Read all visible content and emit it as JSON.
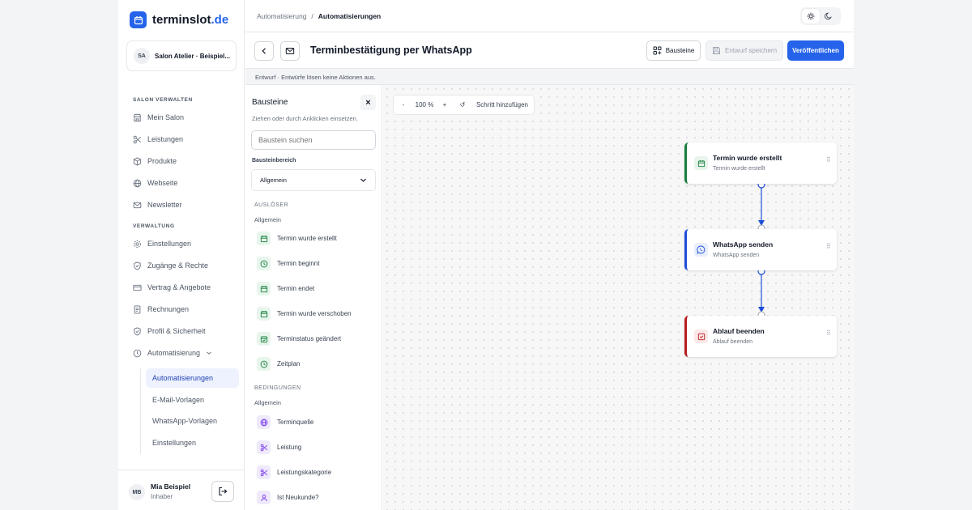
{
  "app": {
    "logo_name": "terminslot",
    "logo_tld": ".de"
  },
  "salon": {
    "initials": "SA",
    "name": "Salon Atelier · Beispiel..."
  },
  "sidebar": {
    "section_salon": "SALON VERWALTEN",
    "section_admin": "VERWALTUNG",
    "items": [
      {
        "label": "Mein Salon",
        "icon": "store-icon"
      },
      {
        "label": "Leistungen",
        "icon": "scissors-icon"
      },
      {
        "label": "Produkte",
        "icon": "box-icon"
      },
      {
        "label": "Webseite",
        "icon": "globe-icon"
      },
      {
        "label": "Newsletter",
        "icon": "mail-icon"
      },
      {
        "label": "Einstellungen",
        "icon": "gear-icon"
      },
      {
        "label": "Zugänge & Rechte",
        "icon": "shield-icon"
      },
      {
        "label": "Vertrag & Angebote",
        "icon": "card-icon"
      },
      {
        "label": "Rechnungen",
        "icon": "receipt-icon"
      },
      {
        "label": "Profil & Sicherheit",
        "icon": "shield-check-icon"
      },
      {
        "label": "Automatisierung",
        "icon": "clock-icon"
      }
    ],
    "sub_items": [
      "Automatisierungen",
      "E-Mail-Vorlagen",
      "WhatsApp-Vorlagen",
      "Einstellungen"
    ]
  },
  "user": {
    "initials": "MB",
    "name": "Mia Beispiel",
    "role": "Inhaber"
  },
  "breadcrumb": {
    "parent": "Automatisierung",
    "separator": "/",
    "current": "Automatisierungen"
  },
  "header": {
    "title": "Terminbestätigung per WhatsApp",
    "bausteine_label": "Bausteine",
    "save_label": "Entwurf speichern",
    "publish_label": "Veröffentlichen"
  },
  "draft_notice": "Entwurf · Entwürfe lösen keine Aktionen aus.",
  "panel": {
    "title": "Bausteine",
    "close": "×",
    "hint": "Ziehen oder durch Anklicken einsetzen.",
    "search_placeholder": "Baustein suchen",
    "area_label": "Bausteinbereich",
    "area_value": "Allgemein",
    "triggers_head": "AUSLÖSER",
    "triggers_sub": "Allgemein",
    "triggers": [
      {
        "label": "Termin wurde erstellt",
        "icon": "calendar-icon"
      },
      {
        "label": "Termin beginnt",
        "icon": "clock-icon"
      },
      {
        "label": "Termin endet",
        "icon": "calendar-icon"
      },
      {
        "label": "Termin wurde verschoben",
        "icon": "calendar-icon"
      },
      {
        "label": "Terminstatus geändert",
        "icon": "calendar-check-icon"
      },
      {
        "label": "Zeitplan",
        "icon": "clock-icon"
      }
    ],
    "conditions_head": "BEDINGUNGEN",
    "conditions_sub": "Allgemein",
    "conditions": [
      {
        "label": "Terminquelle",
        "icon": "globe-icon"
      },
      {
        "label": "Leistung",
        "icon": "scissors-icon"
      },
      {
        "label": "Leistungskategorie",
        "icon": "scissors-icon"
      },
      {
        "label": "Ist Neukunde?",
        "icon": "user-icon"
      }
    ]
  },
  "canvas": {
    "zoom_out": "-",
    "zoom": "100 %",
    "zoom_in": "+",
    "reset": "↺",
    "add_step": "Schritt hinzufügen",
    "nodes": [
      {
        "title": "Termin wurde erstellt",
        "subtitle": "Termin wurde erstellt",
        "color": "#15803d"
      },
      {
        "title": "WhatsApp senden",
        "subtitle": "WhatsApp senden",
        "color": "#1d4ed8"
      },
      {
        "title": "Ablauf beenden",
        "subtitle": "Ablauf beenden",
        "color": "#b91c1c"
      }
    ]
  },
  "colors": {
    "accent": "#2563eb",
    "trigger": "#15803d",
    "action": "#1d4ed8",
    "end": "#b91c1c"
  }
}
